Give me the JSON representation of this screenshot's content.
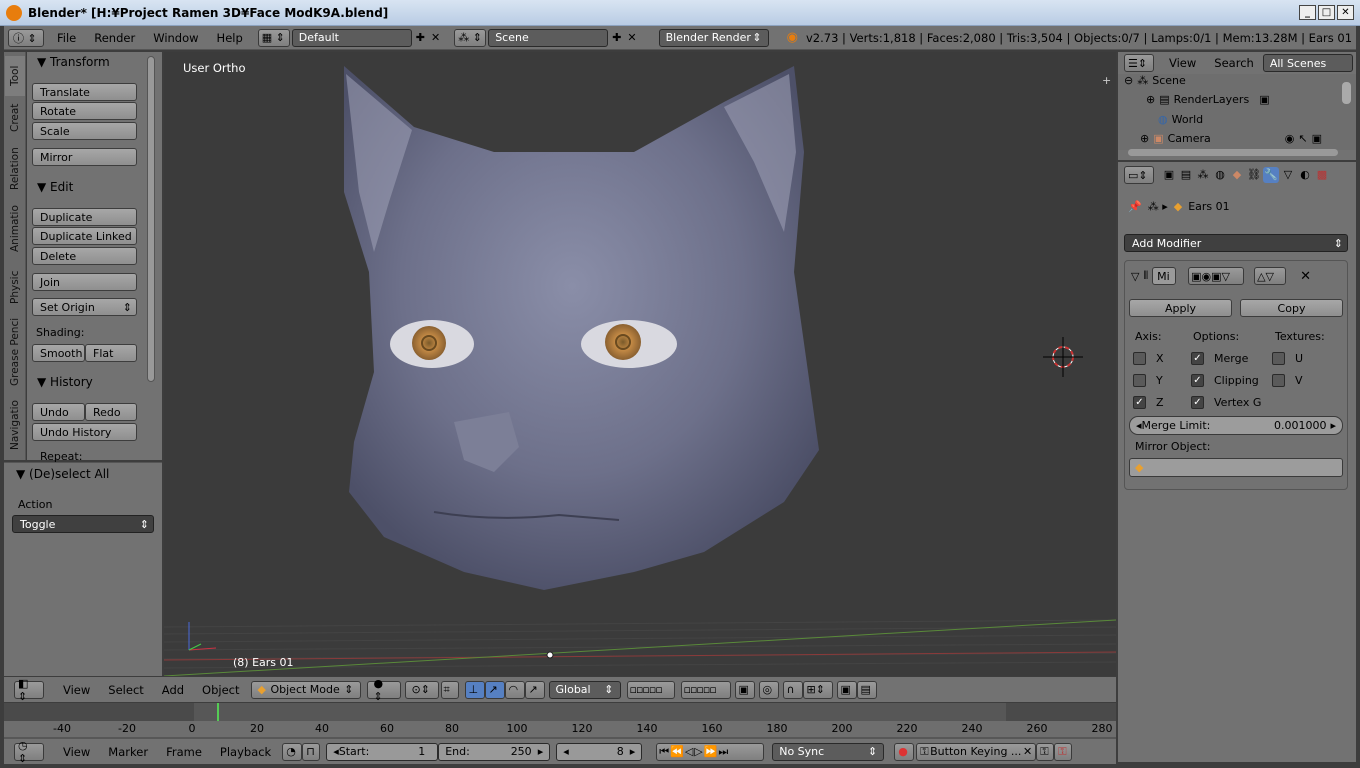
{
  "window": {
    "title": "Blender* [H:¥Project Ramen 3D¥Face ModK9A.blend]",
    "min": "_",
    "max": "□",
    "close": "✕"
  },
  "info_header": {
    "menus": [
      "File",
      "Render",
      "Window",
      "Help"
    ],
    "screen_layout": "Default",
    "scene": "Scene",
    "render_engine": "Blender Render",
    "stats": "v2.73 | Verts:1,818 | Faces:2,080 | Tris:3,504 | Objects:0/7 | Lamps:0/1 | Mem:13.28M | Ears 01"
  },
  "tool_tabs": [
    "Tool",
    "Creat",
    "Relation",
    "Animatio",
    "Physic",
    "Grease Penci",
    "Navigatio"
  ],
  "toolshelf": {
    "transform": {
      "title": "Transform",
      "buttons": [
        "Translate",
        "Rotate",
        "Scale",
        "Mirror"
      ]
    },
    "edit": {
      "title": "Edit",
      "buttons": [
        "Duplicate",
        "Duplicate Linked",
        "Delete",
        "Join"
      ],
      "set_origin": "Set Origin",
      "shading_label": "Shading:",
      "smooth": "Smooth",
      "flat": "Flat"
    },
    "history": {
      "title": "History",
      "undo": "Undo",
      "redo": "Redo",
      "undo_history": "Undo History",
      "repeat": "Repeat:"
    }
  },
  "operator_panel": {
    "title": "(De)select All",
    "action_label": "Action",
    "action_value": "Toggle"
  },
  "viewport": {
    "view_name": "User Ortho",
    "object_label": "(8) Ears 01"
  },
  "view3d_header": {
    "menus": [
      "View",
      "Select",
      "Add",
      "Object"
    ],
    "mode": "Object Mode",
    "orientation": "Global"
  },
  "timeline": {
    "ticks": [
      "-40",
      "-20",
      "0",
      "20",
      "40",
      "60",
      "80",
      "100",
      "120",
      "140",
      "160",
      "180",
      "200",
      "220",
      "240",
      "260",
      "280"
    ],
    "current_frame_fraction": 0.161
  },
  "timeline_header": {
    "menus": [
      "View",
      "Marker",
      "Frame",
      "Playback"
    ],
    "start_label": "Start:",
    "start_value": "1",
    "end_label": "End:",
    "end_value": "250",
    "current_frame": "8",
    "sync": "No Sync",
    "keying": "Button Keying ..."
  },
  "outliner": {
    "menus": [
      "View",
      "Search"
    ],
    "filter": "All Scenes",
    "items": [
      "Scene",
      "RenderLayers",
      "World",
      "Camera"
    ]
  },
  "properties": {
    "object_name": "Ears 01",
    "add_modifier": "Add Modifier",
    "modifier_name": "Mi",
    "apply": "Apply",
    "copy": "Copy",
    "axis_label": "Axis:",
    "options_label": "Options:",
    "textures_label": "Textures:",
    "axis": [
      {
        "label": "X",
        "checked": false
      },
      {
        "label": "Y",
        "checked": false
      },
      {
        "label": "Z",
        "checked": true
      }
    ],
    "options": [
      {
        "label": "Merge",
        "checked": true
      },
      {
        "label": "Clipping",
        "checked": true
      },
      {
        "label": "Vertex G",
        "checked": true
      }
    ],
    "textures": [
      {
        "label": "U",
        "checked": false
      },
      {
        "label": "V",
        "checked": false
      }
    ],
    "merge_limit_label": "Merge Limit:",
    "merge_limit_value": "0.001000",
    "mirror_object_label": "Mirror Object:"
  }
}
